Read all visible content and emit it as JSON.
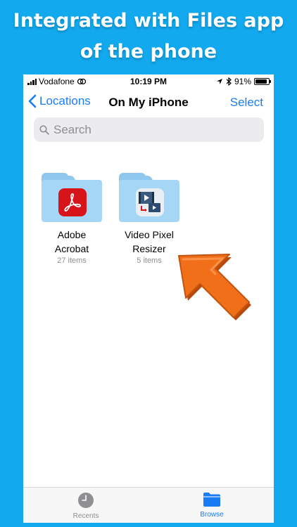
{
  "headline": {
    "line1": "Integrated with Files app",
    "line2": "of the phone"
  },
  "statusbar": {
    "carrier": "Vodafone",
    "time": "10:19 PM",
    "battery": "91%",
    "battery_level": 0.91
  },
  "navbar": {
    "back_label": "Locations",
    "title": "On My iPhone",
    "select_label": "Select"
  },
  "search": {
    "placeholder": "Search"
  },
  "folders": [
    {
      "name_line1": "Adobe",
      "name_line2": "Acrobat",
      "count": "27 items",
      "icon": "adobe-acrobat-icon"
    },
    {
      "name_line1": "Video Pixel",
      "name_line2": "Resizer",
      "count": "5 items",
      "icon": "video-pixel-resizer-icon"
    }
  ],
  "tabbar": {
    "recents_label": "Recents",
    "browse_label": "Browse"
  },
  "colors": {
    "background": "#12a9ef",
    "accent": "#1a7cf5",
    "arrow": "#f26f1a"
  }
}
